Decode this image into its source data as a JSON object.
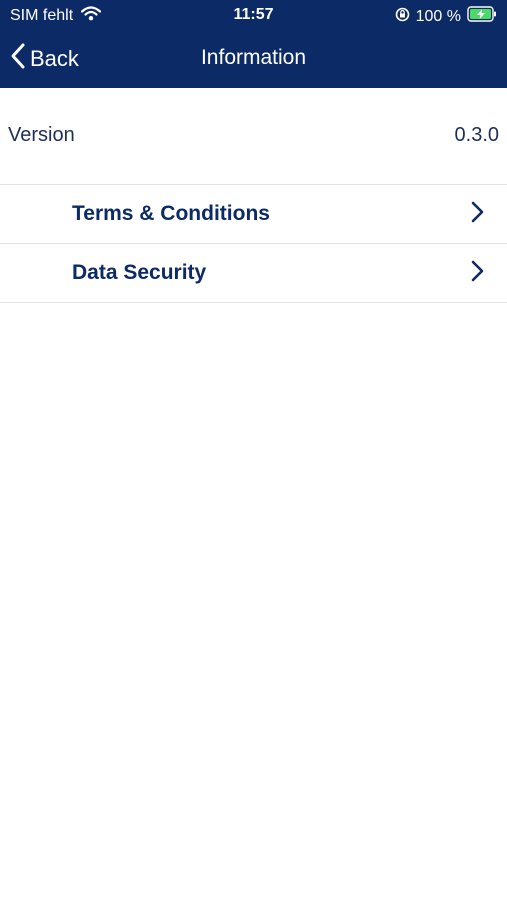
{
  "status_bar": {
    "carrier": "SIM fehlt",
    "time": "11:57",
    "battery": "100 %",
    "icons": [
      "wifi-icon",
      "orientation-lock-icon",
      "battery-charging-icon"
    ]
  },
  "nav": {
    "back_label": "Back",
    "title": "Information",
    "icons": [
      "chevron-left-icon"
    ]
  },
  "version": {
    "label": "Version",
    "value": "0.3.0"
  },
  "menu": {
    "items": [
      {
        "label": "Terms & Conditions",
        "icon": "chevron-right-icon"
      },
      {
        "label": "Data Security",
        "icon": "chevron-right-icon"
      }
    ]
  },
  "colors": {
    "header_bg": "#0c2a66",
    "text_primary": "#0c2a66",
    "divider": "#e3e3e6",
    "battery_green": "#4cd964"
  }
}
